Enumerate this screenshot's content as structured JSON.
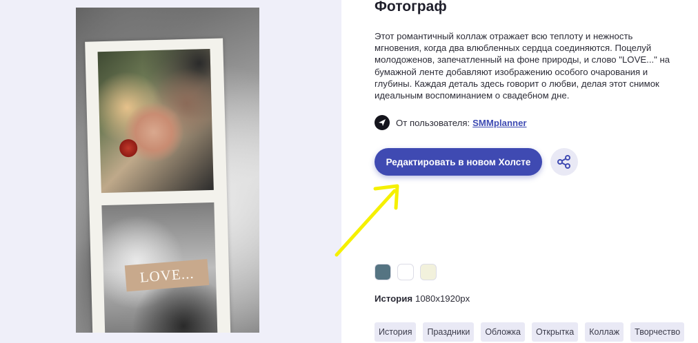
{
  "page": {
    "title": "Фотограф",
    "description": "Этот романтичный коллаж отражает всю теплоту и нежность мгновения, когда два влюбленных сердца соединяются. Поцелуй молодоженов, запечатленный на фоне природы, и слово \"LOVE...\" на бумажной ленте добавляют изображению особого очарования и глубины. Каждая деталь здесь говорит о любви, делая этот снимок идеальным воспоминанием о свадебном дне."
  },
  "preview": {
    "love_text": "LOVE..."
  },
  "author": {
    "prefix": "От пользователя:",
    "name": "SMMplanner"
  },
  "actions": {
    "edit_label": "Редактировать в новом Холсте"
  },
  "palette": [
    "#557482",
    "#ffffff",
    "#f2f1dc"
  ],
  "format": {
    "type": "История",
    "size": "1080x1920px"
  },
  "tags": [
    "История",
    "Праздники",
    "Обложка",
    "Открытка",
    "Коллаж",
    "Творчество"
  ],
  "colors": {
    "accent": "#3f4ab2",
    "link": "#3e4bb3",
    "arrow": "#f5f000",
    "left_background": "#efeff9"
  }
}
